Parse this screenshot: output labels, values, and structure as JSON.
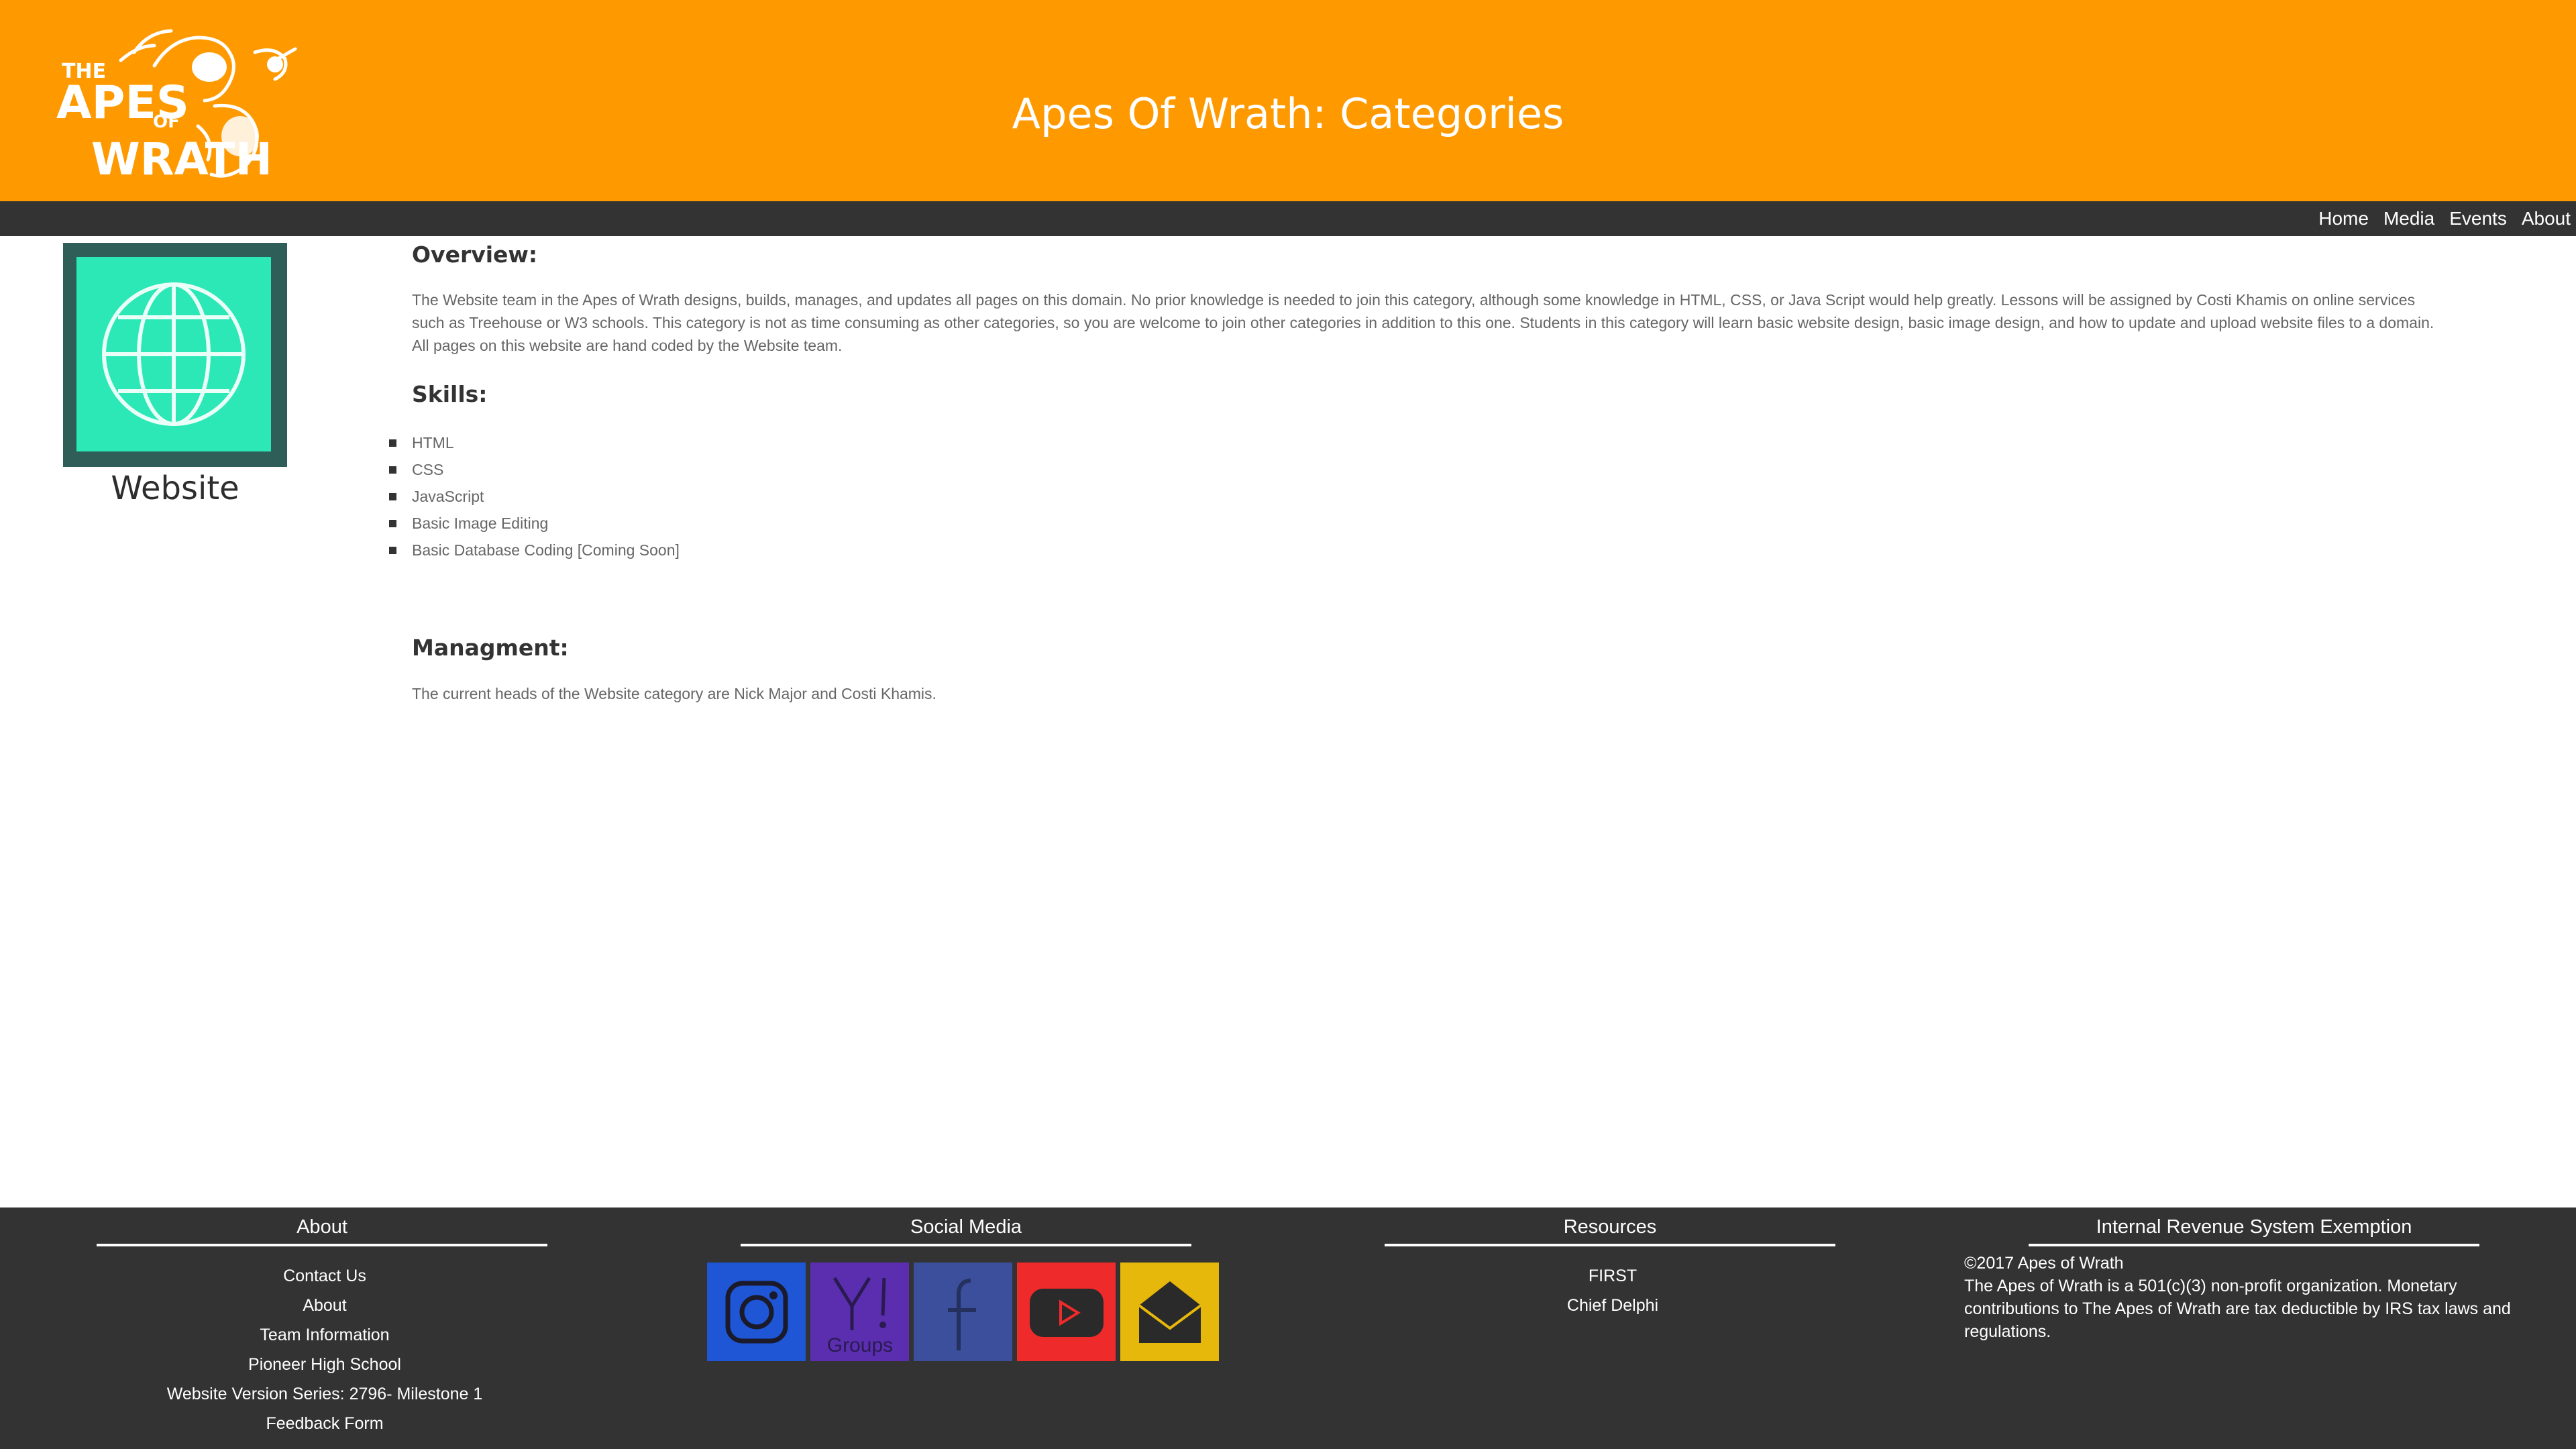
{
  "header": {
    "logo_text": [
      "THE",
      "APES",
      "OF",
      "WRATH"
    ],
    "title": "Apes Of Wrath: Categories"
  },
  "nav": {
    "items": [
      {
        "label": "Home"
      },
      {
        "label": "Media"
      },
      {
        "label": "Events"
      },
      {
        "label": "About"
      }
    ]
  },
  "category": {
    "label": "Website",
    "icon": "globe-icon",
    "card_colors": {
      "outer": "#2f5e58",
      "inner": "#2ce8b7"
    }
  },
  "overview": {
    "heading": "Overview:",
    "text": "The Website team in the Apes of Wrath designs, builds, manages, and updates all pages on this domain. No prior knowledge is needed to join this category, although some knowledge in HTML, CSS, or Java Script would help greatly. Lessons will be assigned by Costi Khamis on online services such as Treehouse or W3 schools. This category is not as time consuming as other categories, so you are welcome to join other categories in addition to this one. Students in this category will learn basic website design, basic image design, and how to update and upload website files to a domain. All pages on this website are hand coded by the Website team."
  },
  "skills": {
    "heading": "Skills:",
    "items": [
      "HTML",
      "CSS",
      "JavaScript",
      "Basic Image Editing",
      "Basic Database Coding [Coming Soon]"
    ]
  },
  "management": {
    "heading": "Managment:",
    "text": "The current heads of the Website category are Nick Major and Costi Khamis."
  },
  "footer": {
    "about": {
      "heading": "About",
      "links": [
        "Contact Us",
        "About",
        "Team Information",
        "Pioneer High School",
        "Website Version Series: 2796- Milestone 1",
        "Feedback Form"
      ]
    },
    "social": {
      "heading": "Social Media",
      "items": [
        {
          "name": "instagram-icon",
          "color": "#1e56d6"
        },
        {
          "name": "yahoo-groups-icon",
          "color": "#5b2eb0",
          "label": "Groups"
        },
        {
          "name": "facebook-icon",
          "color": "#3b4f9c"
        },
        {
          "name": "youtube-icon",
          "color": "#ee2a2a"
        },
        {
          "name": "email-icon",
          "color": "#e6b80c"
        }
      ]
    },
    "resources": {
      "heading": "Resources",
      "links": [
        "FIRST",
        "Chief Delphi"
      ]
    },
    "irs": {
      "heading": "Internal Revenue System Exemption",
      "copyright": "©2017 Apes of Wrath",
      "text": "The Apes of Wrath is a 501(c)(3) non-profit organization. Monetary contributions to The Apes of Wrath are tax deductible by IRS tax laws and regulations."
    }
  }
}
